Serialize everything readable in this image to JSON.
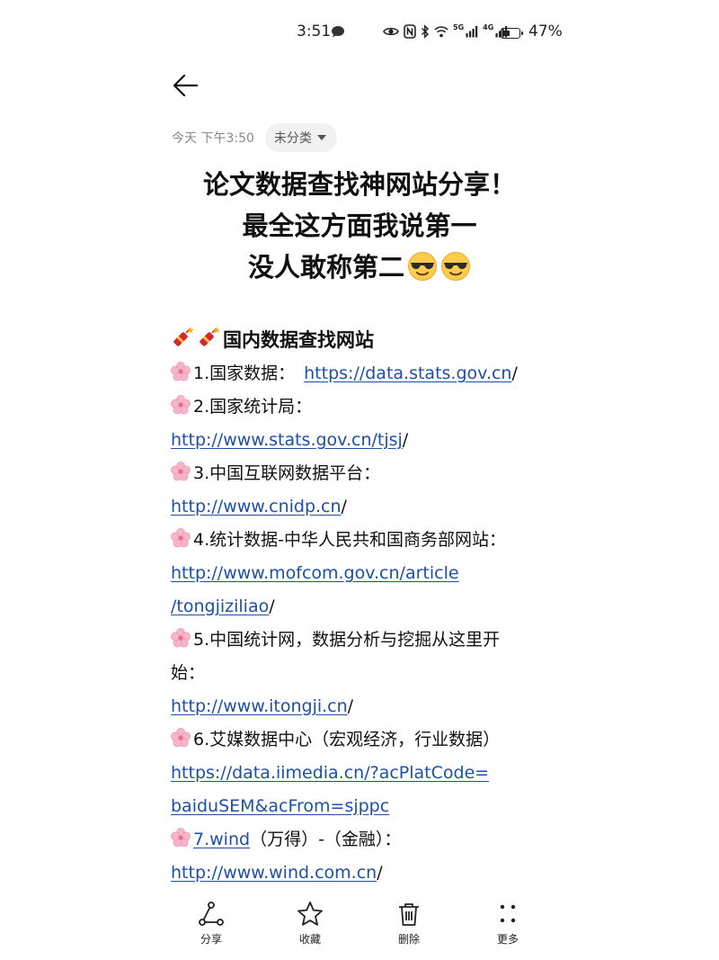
{
  "status_bar": {
    "time": "3:51",
    "network_5g": "5G",
    "network_4g": "4G",
    "battery": "47%",
    "battery_level": 0.47
  },
  "note": {
    "date": "今天 下午3:50",
    "category": "未分类",
    "title_lines": [
      "论文数据查找神网站分享！",
      "最全这方面我说第一",
      "没人敢称第二"
    ],
    "section_heading": "国内数据查找网站",
    "items": {
      "i1_text": "1.国家数据：",
      "i1_link": "https://data.stats.gov.cn",
      "i1_tail": "/",
      "i2_text": "2.国家统计局：",
      "i2_link": "http://www.stats.gov.cn/tjsj",
      "i2_tail": "/",
      "i3_text": "3.中国互联网数据平台：",
      "i3_link": "http://www.cnidp.cn",
      "i3_tail": "/",
      "i4_text": "4.统计数据-中华人民共和国商务部网站：",
      "i4_link_a": "http://www.mofcom.gov.cn/article",
      "i4_link_b": "/tongjiziliao",
      "i4_tail": "/",
      "i5_text_a": "5.中国统计网，数据分析与挖掘从这里开",
      "i5_text_b": "始：",
      "i5_link": "http://www.itongji.cn",
      "i5_tail": "/",
      "i6_text": "6.艾媒数据中心（宏观经济，行业数据）",
      "i6_link_a": "https://data.iimedia.cn/?acPlatCode=",
      "i6_link_b": "baiduSEM&acFrom=sjppc",
      "i7_link": "7.wind",
      "i7_text": "（万得）-（金融）：",
      "i7b_link": "http://www.wind.com.cn",
      "i7b_tail": "/"
    }
  },
  "toolbar": {
    "share": "分享",
    "favorite": "收藏",
    "delete": "删除",
    "more": "更多"
  },
  "colors": {
    "link": "#1d4fa8",
    "text": "#111111",
    "muted": "#8a8a8a",
    "chip_bg": "#f1f1f1"
  },
  "icons": {
    "back": "arrow-left-icon",
    "share": "share-icon",
    "favorite": "star-icon",
    "delete": "trash-icon",
    "more": "more-dots-icon",
    "bullet": "cherry-blossom-icon",
    "heading": "firecracker-icon",
    "title_emoji": "sunglasses-face-icon"
  }
}
